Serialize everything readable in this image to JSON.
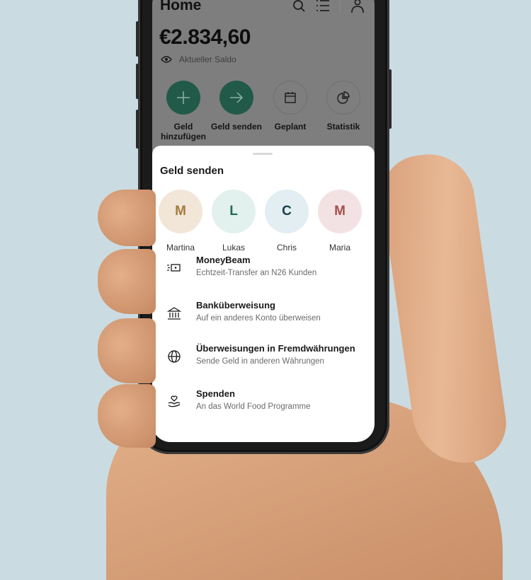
{
  "header": {
    "title": "Home",
    "icons": [
      "search-icon",
      "list-icon",
      "profile-icon"
    ]
  },
  "balance": {
    "amount": "€2.834,60",
    "label": "Aktueller Saldo",
    "visibility_icon": "eye-icon"
  },
  "actions": [
    {
      "label": "Geld hinzufügen",
      "icon": "plus-icon",
      "style": "filled"
    },
    {
      "label": "Geld senden",
      "icon": "arrow-right-icon",
      "style": "filled"
    },
    {
      "label": "Geplant",
      "icon": "calendar-icon",
      "style": "outline"
    },
    {
      "label": "Statistik",
      "icon": "pie-chart-icon",
      "style": "outline"
    }
  ],
  "sheet": {
    "title": "Geld senden",
    "contacts": [
      {
        "initial": "M",
        "name": "Martina",
        "bg": "#f1e6d8",
        "fg": "#a47a3c"
      },
      {
        "initial": "L",
        "name": "Lukas",
        "bg": "#e2f0ee",
        "fg": "#1f6b55"
      },
      {
        "initial": "C",
        "name": "Chris",
        "bg": "#e2eef1",
        "fg": "#173f4a"
      },
      {
        "initial": "M",
        "name": "Maria",
        "bg": "#f3e2e4",
        "fg": "#a2504d"
      }
    ],
    "options": [
      {
        "title": "MoneyBeam",
        "subtitle": "Echtzeit-Transfer an N26 Kunden",
        "icon": "moneybeam-icon"
      },
      {
        "title": "Banküberweisung",
        "subtitle": "Auf ein anderes Konto überweisen",
        "icon": "bank-icon"
      },
      {
        "title": "Überweisungen in Fremdwährungen",
        "subtitle": "Sende Geld in anderen Währungen",
        "icon": "globe-icon"
      },
      {
        "title": "Spenden",
        "subtitle": "An das World Food Programme",
        "icon": "donate-heart-hand-icon"
      }
    ]
  },
  "colors": {
    "accent": "#225a4a",
    "background": "#cbdbe2"
  }
}
